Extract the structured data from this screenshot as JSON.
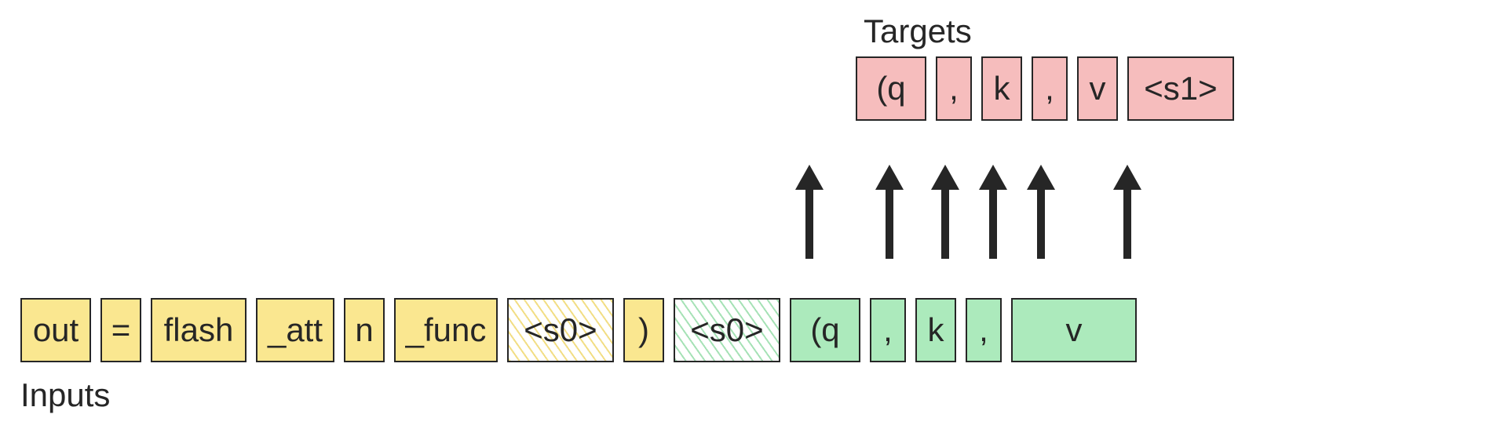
{
  "labels": {
    "targets": "Targets",
    "inputs": "Inputs"
  },
  "colors": {
    "yellow": "#fae790",
    "green": "#aceabc",
    "pink": "#f6bdbd",
    "stroke": "#262626",
    "arrow": "#262626",
    "bg": "#ffffff"
  },
  "targets_row": [
    {
      "text": "(q",
      "fill": "pink"
    },
    {
      "text": ",",
      "fill": "pink"
    },
    {
      "text": "k",
      "fill": "pink"
    },
    {
      "text": ",",
      "fill": "pink"
    },
    {
      "text": "v",
      "fill": "pink"
    },
    {
      "text": "<s1>",
      "fill": "pink"
    }
  ],
  "inputs_row": [
    {
      "text": "out",
      "fill": "yellow"
    },
    {
      "text": "=",
      "fill": "yellow"
    },
    {
      "text": "flash",
      "fill": "yellow"
    },
    {
      "text": "_att",
      "fill": "yellow"
    },
    {
      "text": "n",
      "fill": "yellow"
    },
    {
      "text": "_func",
      "fill": "yellow"
    },
    {
      "text": "<s0>",
      "fill": "hatched-yellow"
    },
    {
      "text": ")",
      "fill": "yellow"
    },
    {
      "text": "<s0>",
      "fill": "hatched-green"
    },
    {
      "text": "(q",
      "fill": "green"
    },
    {
      "text": ",",
      "fill": "green"
    },
    {
      "text": "k",
      "fill": "green"
    },
    {
      "text": ",",
      "fill": "green"
    },
    {
      "text": "v",
      "fill": "green"
    }
  ],
  "arrows_count": 6,
  "source_sequence": "out = flash_attn_func(<s0>) <s0> (q , k , v",
  "target_sequence": "(q , k , v <s1>"
}
